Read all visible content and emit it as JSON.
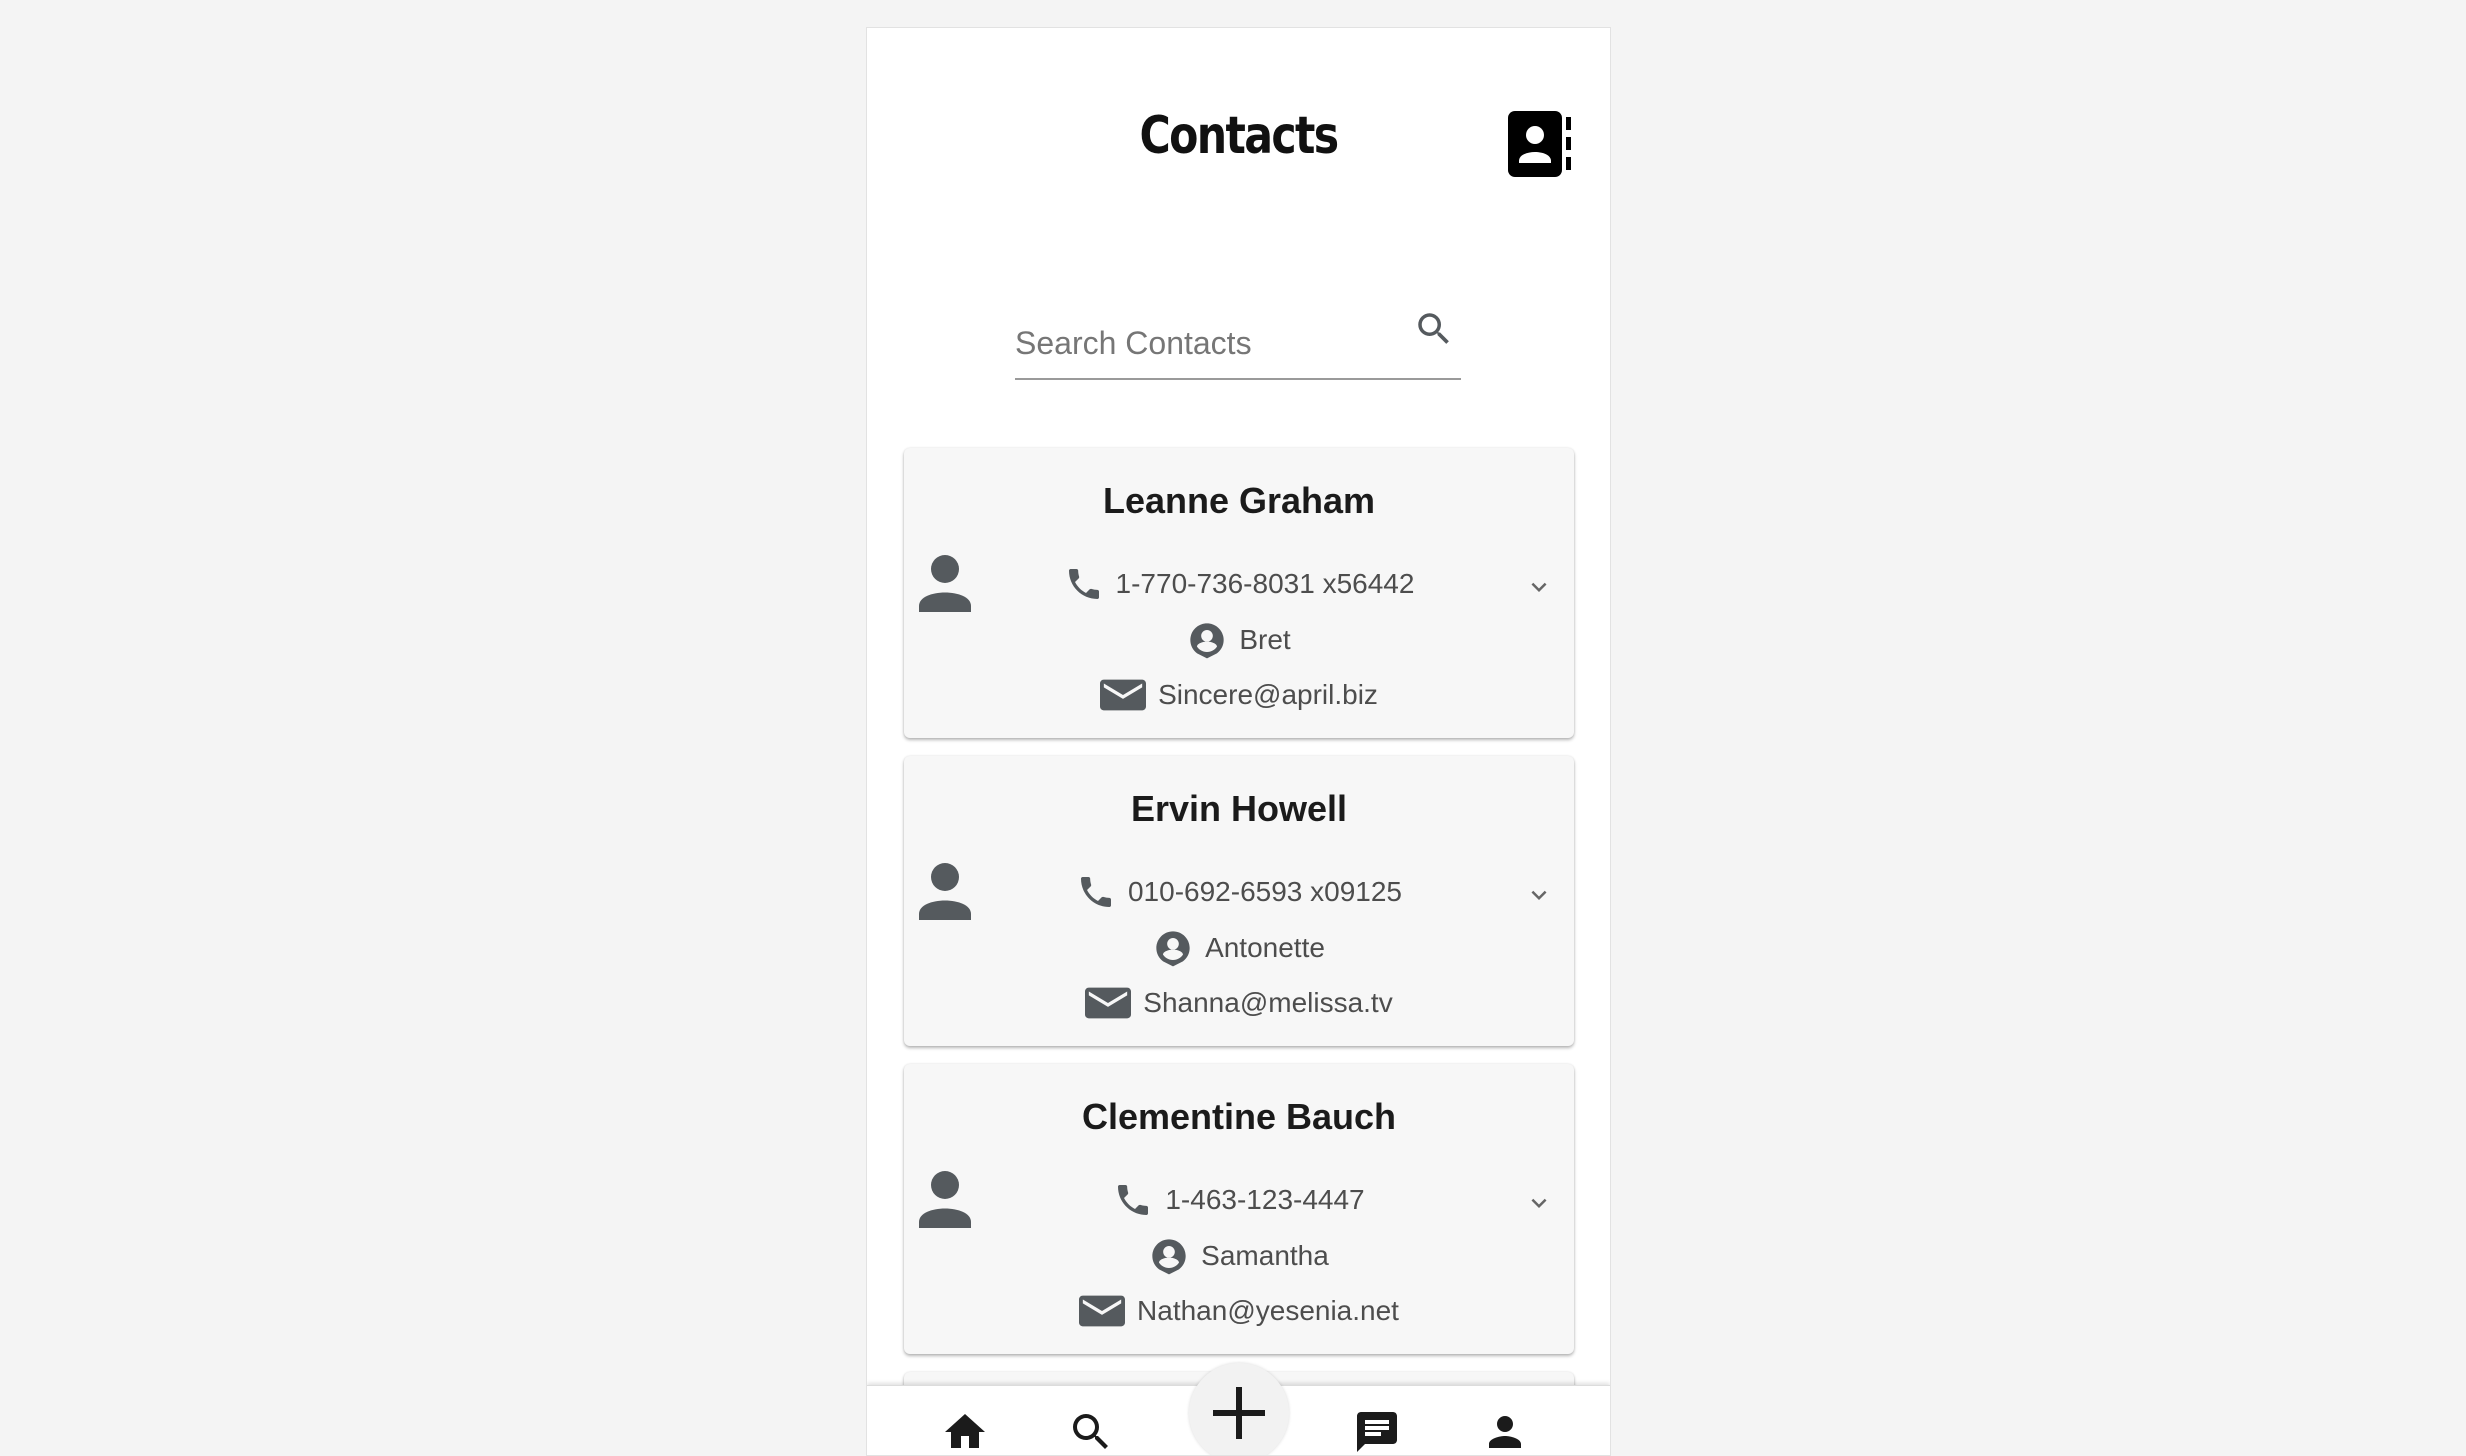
{
  "header": {
    "title": "Contacts",
    "icon": "contacts-book-icon"
  },
  "search": {
    "placeholder": "Search Contacts",
    "value": "",
    "icon": "search-icon"
  },
  "contacts": [
    {
      "name": "Leanne Graham",
      "phone": "1-770-736-8031 x56442",
      "username": "Bret",
      "email": "Sincere@april.biz"
    },
    {
      "name": "Ervin Howell",
      "phone": "010-692-6593 x09125",
      "username": "Antonette",
      "email": "Shanna@melissa.tv"
    },
    {
      "name": "Clementine Bauch",
      "phone": "1-463-123-4447",
      "username": "Samantha",
      "email": "Nathan@yesenia.net"
    }
  ],
  "bottom_nav": {
    "items": [
      "home-icon",
      "search-icon",
      "add-icon",
      "messages-icon",
      "profile-icon"
    ]
  },
  "colors": {
    "background": "#f4f4f4",
    "card": "#f7f7f7",
    "icon": "#555a5e",
    "text": "#4d4d4d"
  }
}
